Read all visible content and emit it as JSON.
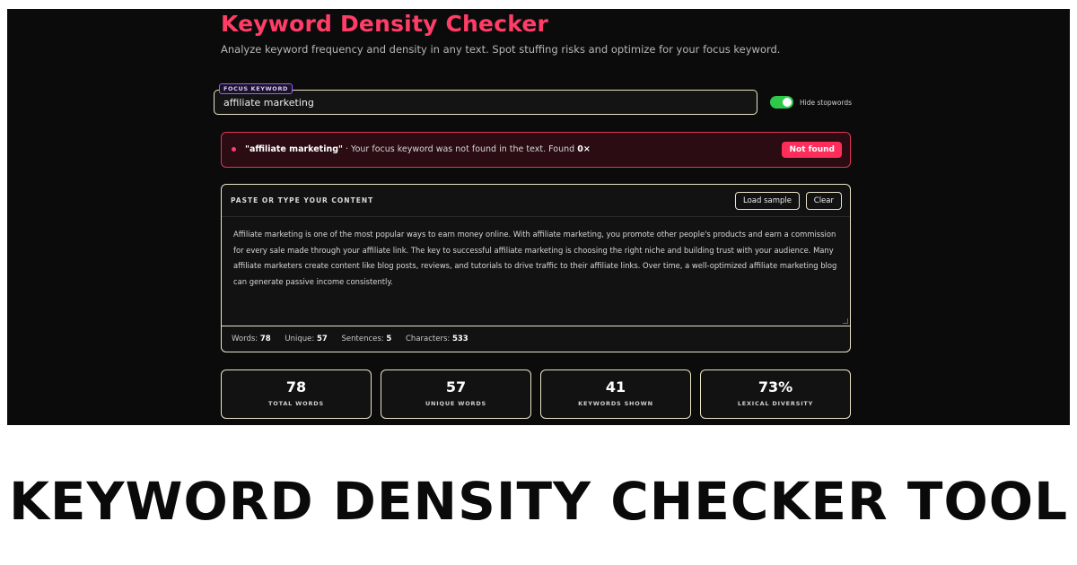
{
  "app": {
    "title": "Keyword Density Checker",
    "subtitle": "Analyze keyword frequency and density in any text. Spot stuffing risks and optimize for your focus keyword."
  },
  "focus_keyword": {
    "tag": "FOCUS KEYWORD",
    "value": "affiliate marketing"
  },
  "toggle": {
    "label": "Hide stopwords",
    "on": true
  },
  "alert": {
    "keyword": "\"affiliate marketing\"",
    "message": " · Your focus keyword was not found in the text. Found ",
    "count": "0×",
    "badge": "Not found"
  },
  "content": {
    "label": "PASTE OR TYPE YOUR CONTENT",
    "load_sample": "Load sample",
    "clear": "Clear",
    "text": "Affiliate marketing is one of the most popular ways to earn money online. With affiliate marketing, you promote other people's products and earn a commission for every sale made through your affiliate link. The key to successful affiliate marketing is choosing the right niche and building trust with your audience. Many affiliate marketers create content like blog posts, reviews, and tutorials to drive traffic to their affiliate links. Over time, a well-optimized affiliate marketing blog can generate passive income consistently.",
    "stats": [
      {
        "label": "Words:",
        "value": "78"
      },
      {
        "label": "Unique:",
        "value": "57"
      },
      {
        "label": "Sentences:",
        "value": "5"
      },
      {
        "label": "Characters:",
        "value": "533"
      }
    ]
  },
  "cards": [
    {
      "value": "78",
      "label": "TOTAL WORDS"
    },
    {
      "value": "57",
      "label": "UNIQUE WORDS"
    },
    {
      "value": "41",
      "label": "KEYWORDS SHOWN"
    },
    {
      "value": "73%",
      "label": "LEXICAL DIVERSITY"
    }
  ],
  "banner": {
    "text": "KEYWORD DENSITY CHECKER TOOL"
  },
  "colors": {
    "accent": "#ff3d66",
    "background": "#0b0b0c",
    "border": "#e9e4c6",
    "toggle_on": "#2ec94a",
    "alert_bg": "#2a0c12"
  }
}
